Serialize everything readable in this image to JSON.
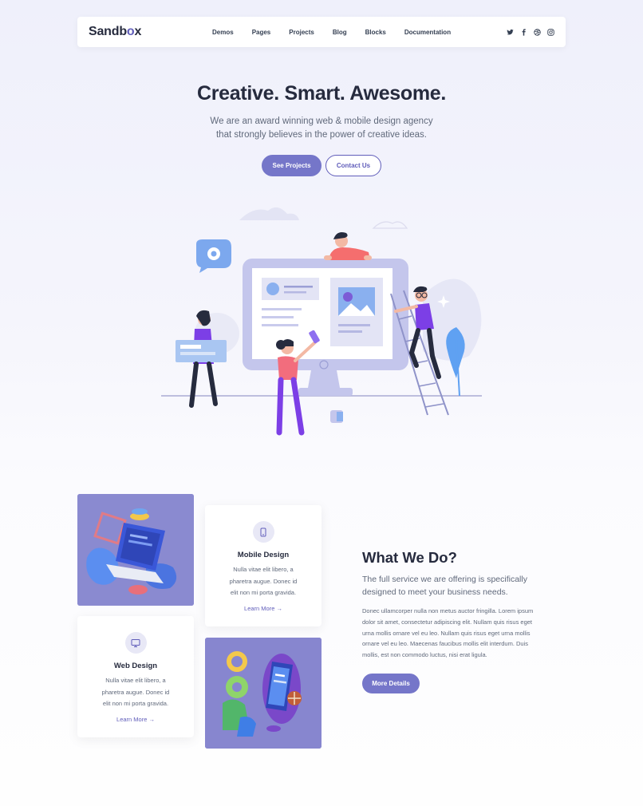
{
  "nav": {
    "logo_main": "Sandb",
    "logo_accent": "o",
    "logo_end": "x",
    "links": [
      "Demos",
      "Pages",
      "Projects",
      "Blog",
      "Blocks",
      "Documentation"
    ],
    "socials": [
      "twitter-icon",
      "facebook-icon",
      "dribbble-icon",
      "instagram-icon"
    ]
  },
  "hero": {
    "title": "Creative. Smart. Awesome.",
    "subtitle_line1": "We are an award winning web & mobile design agency",
    "subtitle_line2": "that strongly believes in the power of creative ideas.",
    "primary_button": "See Projects",
    "secondary_button": "Contact Us"
  },
  "services": [
    {
      "title": "Mobile Design",
      "icon": "phone-icon",
      "text_line1": "Nulla vitae elit libero, a",
      "text_line2": "pharetra augue. Donec id",
      "text_line3": "elit non mi porta gravida.",
      "link": "Learn More →"
    },
    {
      "title": "Web Design",
      "icon": "monitor-icon",
      "text_line1": "Nulla vitae elit libero, a",
      "text_line2": "pharetra augue. Donec id",
      "text_line3": "elit non mi porta gravida.",
      "link": "Learn More →"
    }
  ],
  "what_we_do": {
    "title": "What We Do?",
    "lead_line1": "The full service we are offering is specifically",
    "lead_line2": "designed to meet your business needs.",
    "body_lines": [
      "Donec ullamcorper nulla non metus auctor fringilla. Lorem ipsum",
      "dolor sit amet, consectetur adipiscing elit. Nullam quis risus eget",
      "urna mollis ornare vel eu leo. Nullam quis risus eget urna mollis",
      "ornare vel eu leo. Maecenas faucibus mollis elit interdum. Duis",
      "mollis, est non commodo luctus, nisi erat ligula."
    ],
    "button": "More Details"
  },
  "colors": {
    "accent": "#605dba",
    "button_fill": "#7576c9",
    "heading": "#262b3e",
    "body_text": "#60697b"
  }
}
